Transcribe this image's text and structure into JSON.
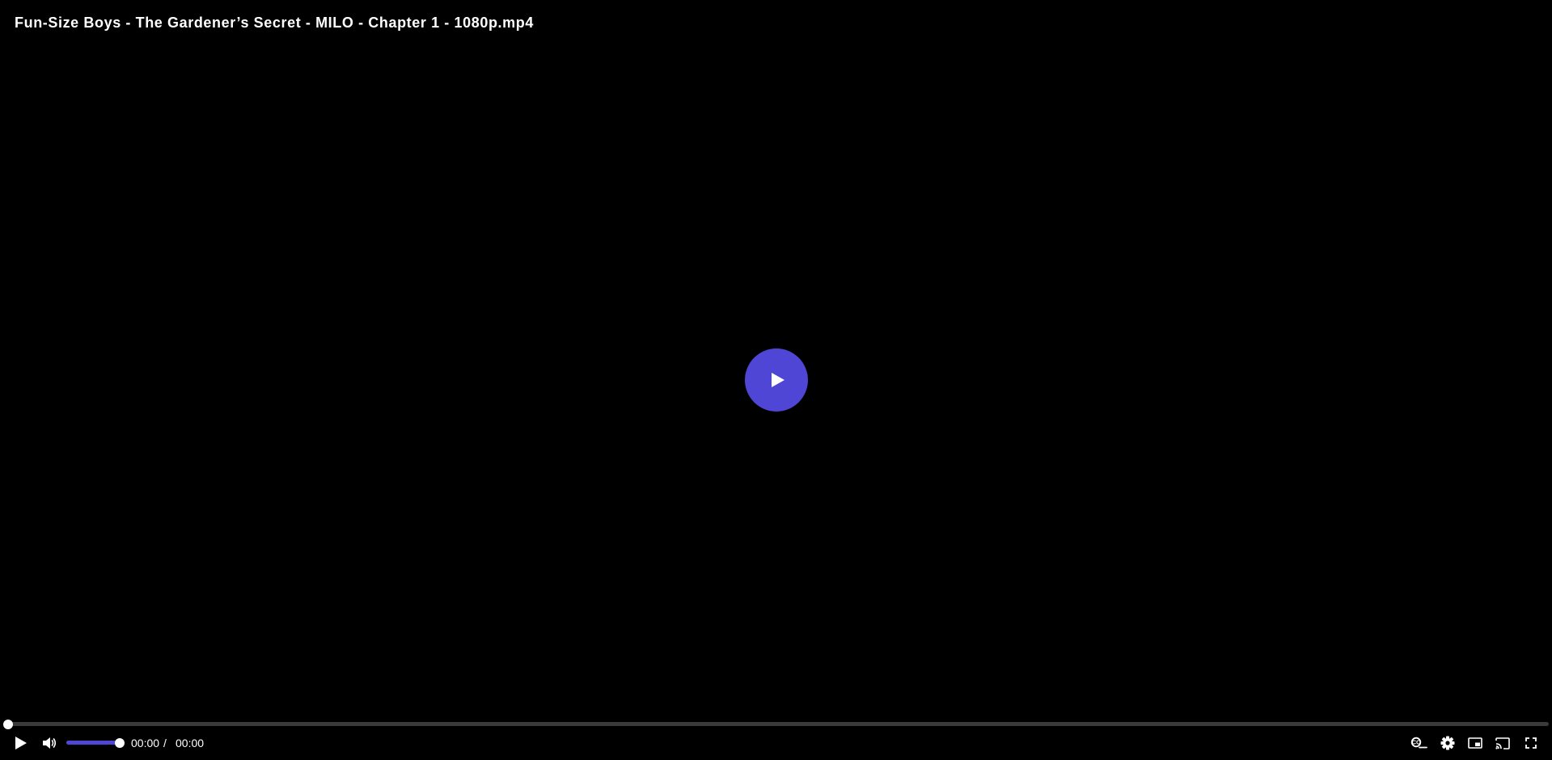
{
  "video": {
    "title": "Fun-Size Boys - The Gardener’s Secret - MILO - Chapter 1 - 1080p.mp4"
  },
  "theme": {
    "accent": "#4f46d6",
    "background": "#000000",
    "track": "#3a3a3a",
    "text": "#ffffff"
  },
  "playback": {
    "progress_fraction": 0,
    "volume_fraction": 1,
    "current_time": "00:00",
    "separator": "/",
    "duration": "00:00"
  },
  "icons": {
    "big_play": "play-icon",
    "play": "play-icon",
    "volume": "volume-icon",
    "captions": "captions-icon",
    "settings": "gear-icon",
    "pip": "picture-in-picture-icon",
    "cast": "cast-icon",
    "fullscreen": "fullscreen-icon"
  }
}
